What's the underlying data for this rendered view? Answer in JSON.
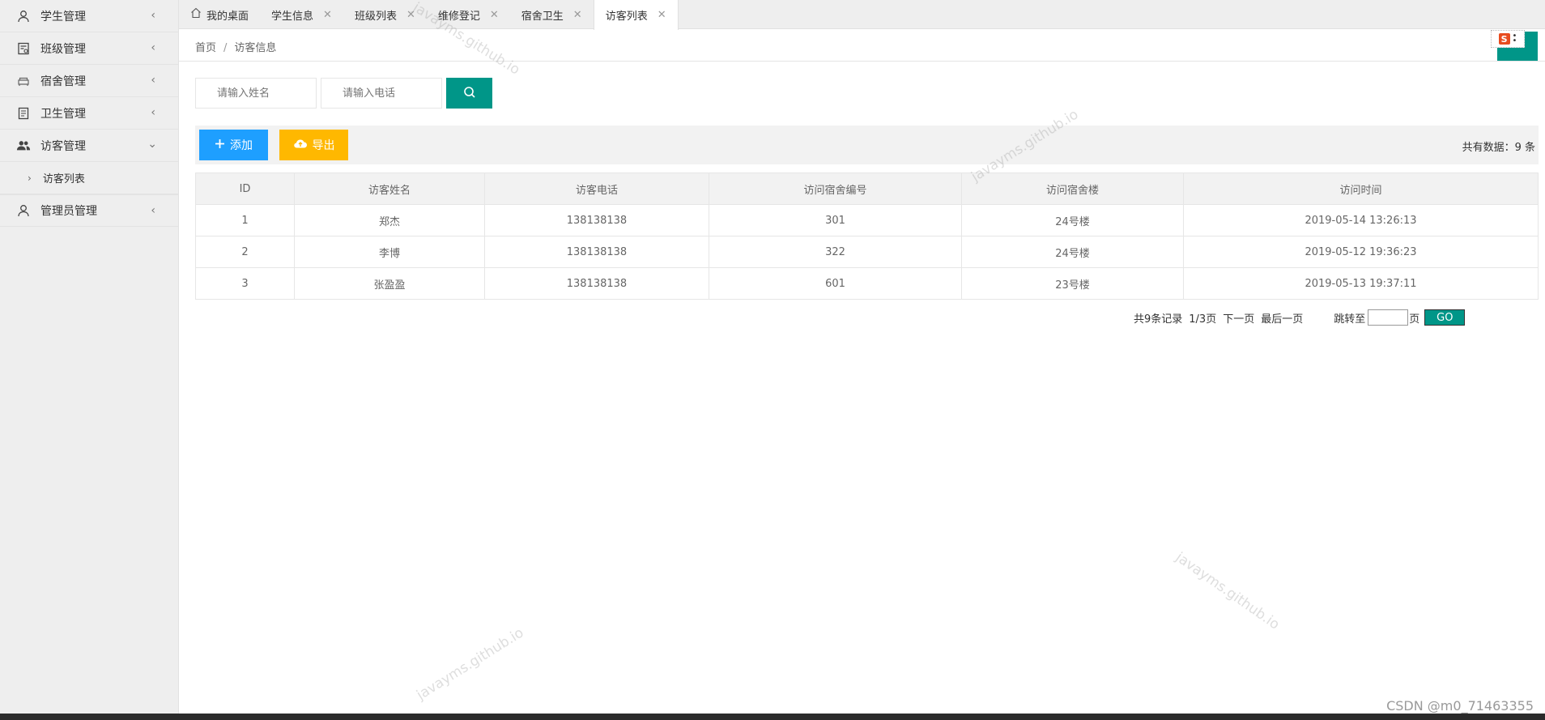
{
  "sidebar": {
    "items": [
      {
        "label": "学生管理",
        "icon": "user-icon"
      },
      {
        "label": "班级管理",
        "icon": "class-icon"
      },
      {
        "label": "宿舍管理",
        "icon": "sofa-icon"
      },
      {
        "label": "卫生管理",
        "icon": "document-icon"
      },
      {
        "label": "访客管理",
        "icon": "users-icon",
        "open": true
      }
    ],
    "sub_items": [
      {
        "label": "访客列表"
      }
    ],
    "admin": {
      "label": "管理员管理",
      "icon": "admin-icon"
    }
  },
  "tabs": [
    {
      "label": "我的桌面",
      "home": true
    },
    {
      "label": "学生信息"
    },
    {
      "label": "班级列表"
    },
    {
      "label": "维修登记"
    },
    {
      "label": "宿舍卫生"
    },
    {
      "label": "访客列表",
      "active": true
    }
  ],
  "breadcrumb": {
    "home": "首页",
    "separator": "/",
    "current": "访客信息"
  },
  "search": {
    "name_placeholder": "请输入姓名",
    "phone_placeholder": "请输入电话"
  },
  "toolbar": {
    "add_label": "添加",
    "export_label": "导出",
    "total_text": "共有数据：9 条"
  },
  "table": {
    "headers": [
      "ID",
      "访客姓名",
      "访客电话",
      "访问宿舍编号",
      "访问宿舍楼",
      "访问时间"
    ],
    "rows": [
      [
        "1",
        "郑杰",
        "138138138",
        "301",
        "24号楼",
        "2019-05-14 13:26:13"
      ],
      [
        "2",
        "李博",
        "138138138",
        "322",
        "24号楼",
        "2019-05-12 19:36:23"
      ],
      [
        "3",
        "张盈盈",
        "138138138",
        "601",
        "23号楼",
        "2019-05-13 19:37:11"
      ]
    ]
  },
  "pager": {
    "records": "共9条记录",
    "page": "1/3页",
    "next": "下一页",
    "last": "最后一页",
    "jump_label": "跳转至",
    "page_unit": "页",
    "go": "GO"
  },
  "watermarks": [
    "javayms.github.io",
    "javayms.github.io",
    "javayms.github.io",
    "javayms.github.io"
  ],
  "credit": "CSDN @m0_71463355",
  "colors": {
    "primary": "#009688",
    "add": "#1E9FFF",
    "export": "#FFB800"
  }
}
